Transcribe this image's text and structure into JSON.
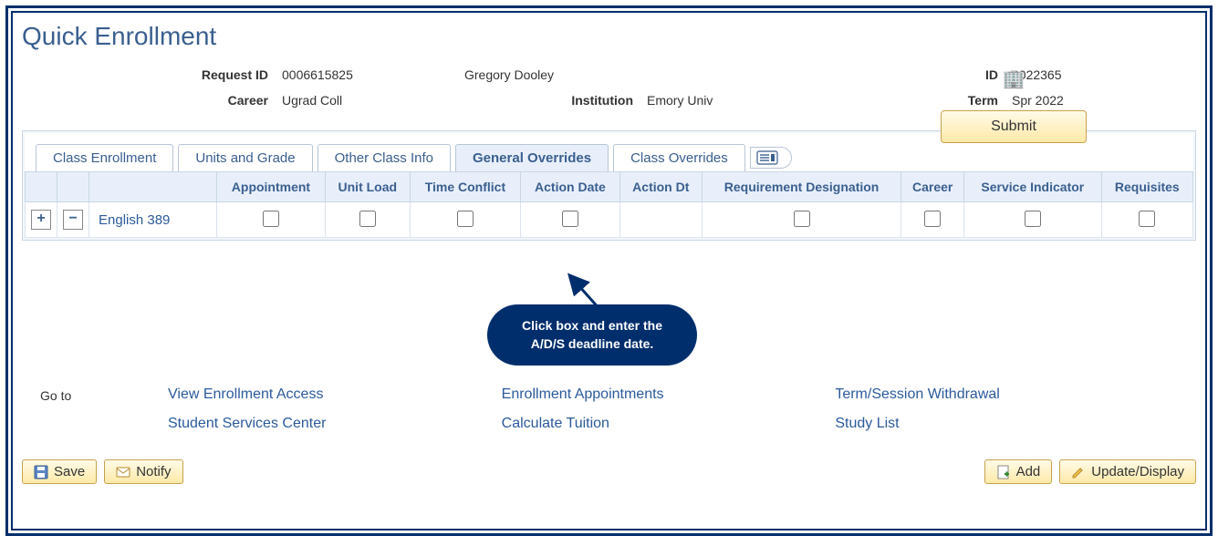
{
  "page": {
    "title": "Quick Enrollment"
  },
  "header": {
    "request_id_label": "Request ID",
    "request_id": "0006615825",
    "student_name": "Gregory Dooley",
    "id_label": "ID",
    "id": "0022365",
    "career_label": "Career",
    "career": "Ugrad Coll",
    "institution_label": "Institution",
    "institution": "Emory Univ",
    "term_label": "Term",
    "term": "Spr 2022",
    "submit_label": "Submit"
  },
  "tabs": {
    "class_enrollment": "Class Enrollment",
    "units_grade": "Units and Grade",
    "other_info": "Other Class Info",
    "general_overrides": "General Overrides",
    "class_overrides": "Class Overrides"
  },
  "table": {
    "columns": {
      "appointment": "Appointment",
      "unit_load": "Unit Load",
      "time_conflict": "Time Conflict",
      "action_date": "Action Date",
      "action_dt": "Action Dt",
      "req_desig": "Requirement Designation",
      "career": "Career",
      "service_ind": "Service Indicator",
      "requisites": "Requisites"
    },
    "rows": [
      {
        "class_name": "English 389"
      }
    ]
  },
  "callout": {
    "line1": "Click box and enter the",
    "line2": "A/D/S deadline date."
  },
  "links": {
    "goto": "Go to",
    "view_enrollment_access": "View Enrollment Access",
    "enrollment_appointments": "Enrollment Appointments",
    "term_withdrawal": "Term/Session Withdrawal",
    "student_services": "Student Services Center",
    "calculate_tuition": "Calculate Tuition",
    "study_list": "Study List"
  },
  "footer": {
    "save": "Save",
    "notify": "Notify",
    "add": "Add",
    "update": "Update/Display"
  }
}
